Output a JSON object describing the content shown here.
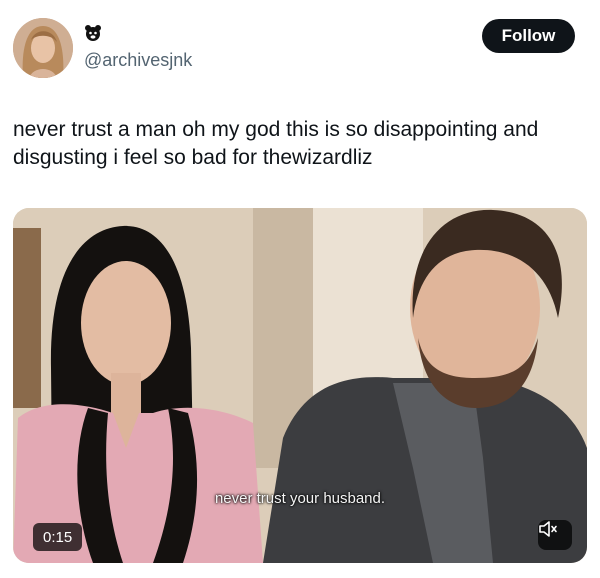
{
  "author": {
    "handle": "@archivesjnk",
    "badge_icon": "bear-face-icon"
  },
  "follow_label": "Follow",
  "tweet_text": "never trust a man oh my god this is so disappointing and disgusting i feel so bad for thewizardliz",
  "video": {
    "subtitle": "never trust your husband.",
    "time": "0:15",
    "mute_icon": "speaker-muted-icon"
  }
}
